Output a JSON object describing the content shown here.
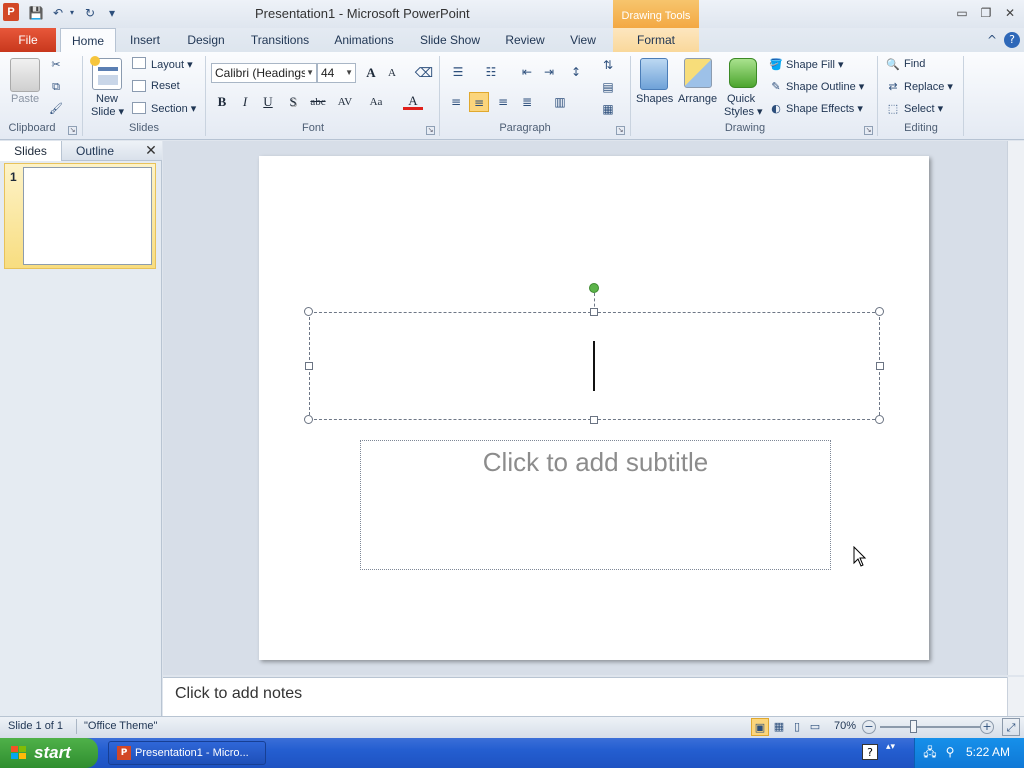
{
  "window": {
    "title": "Presentation1  -  Microsoft PowerPoint",
    "app_icon_letter": "P",
    "contextual_group": "Drawing Tools",
    "controls": {
      "minimize": "▭",
      "restore": "❐",
      "close": "✕"
    }
  },
  "quick_access": {
    "save": "💾",
    "undo": "↶",
    "redo": "↻",
    "customize": "▾"
  },
  "tabs": {
    "file": "File",
    "items": [
      "Home",
      "Insert",
      "Design",
      "Transitions",
      "Animations",
      "Slide Show",
      "Review",
      "View"
    ],
    "contextual": "Format",
    "help_icon": "?",
    "collapse_icon": "^"
  },
  "ribbon": {
    "clipboard": {
      "label": "Clipboard",
      "paste": "Paste",
      "cut": "✂",
      "copy": "⧉",
      "format_painter": "🖌"
    },
    "slides": {
      "label": "Slides",
      "new_slide": "New",
      "new_slide_line2": "Slide ▾",
      "layout": "Layout ▾",
      "reset": "Reset",
      "section": "Section ▾"
    },
    "font": {
      "label": "Font",
      "font_name": "Calibri (Headings)",
      "font_size": "44",
      "grow": "A",
      "shrink": "A",
      "clear": "⌫",
      "bold": "B",
      "italic": "I",
      "underline": "U",
      "shadow": "S",
      "strike": "abc",
      "spacing": "AV",
      "case": "Aa",
      "color": "A"
    },
    "paragraph": {
      "label": "Paragraph"
    },
    "drawing": {
      "label": "Drawing",
      "shapes": "Shapes",
      "arrange": "Arrange",
      "quick_styles": "Quick",
      "quick_styles_line2": "Styles ▾",
      "shape_fill": "Shape Fill ▾",
      "shape_outline": "Shape Outline ▾",
      "shape_effects": "Shape Effects ▾"
    },
    "editing": {
      "label": "Editing",
      "find": "Find",
      "replace": "Replace ▾",
      "select": "Select ▾"
    }
  },
  "left_pane": {
    "tab_slides": "Slides",
    "tab_outline": "Outline",
    "close": "✕",
    "slide_number": "1"
  },
  "slide": {
    "subtitle_placeholder": "Click to add subtitle"
  },
  "notes": {
    "placeholder": "Click to add notes"
  },
  "status": {
    "slide_info": "Slide 1 of 1",
    "theme": "\"Office Theme\"",
    "zoom": "70%",
    "zoom_level_percent": 70,
    "zoom_out": "−",
    "zoom_in": "+"
  },
  "taskbar": {
    "start": "start",
    "task": "Presentation1 - Micro...",
    "time": "5:22 AM"
  },
  "colors": {
    "accent_file": "#d24726",
    "contextual_tab": "#f3a843",
    "taskbar": "#245ed0",
    "start": "#3a9e38"
  }
}
